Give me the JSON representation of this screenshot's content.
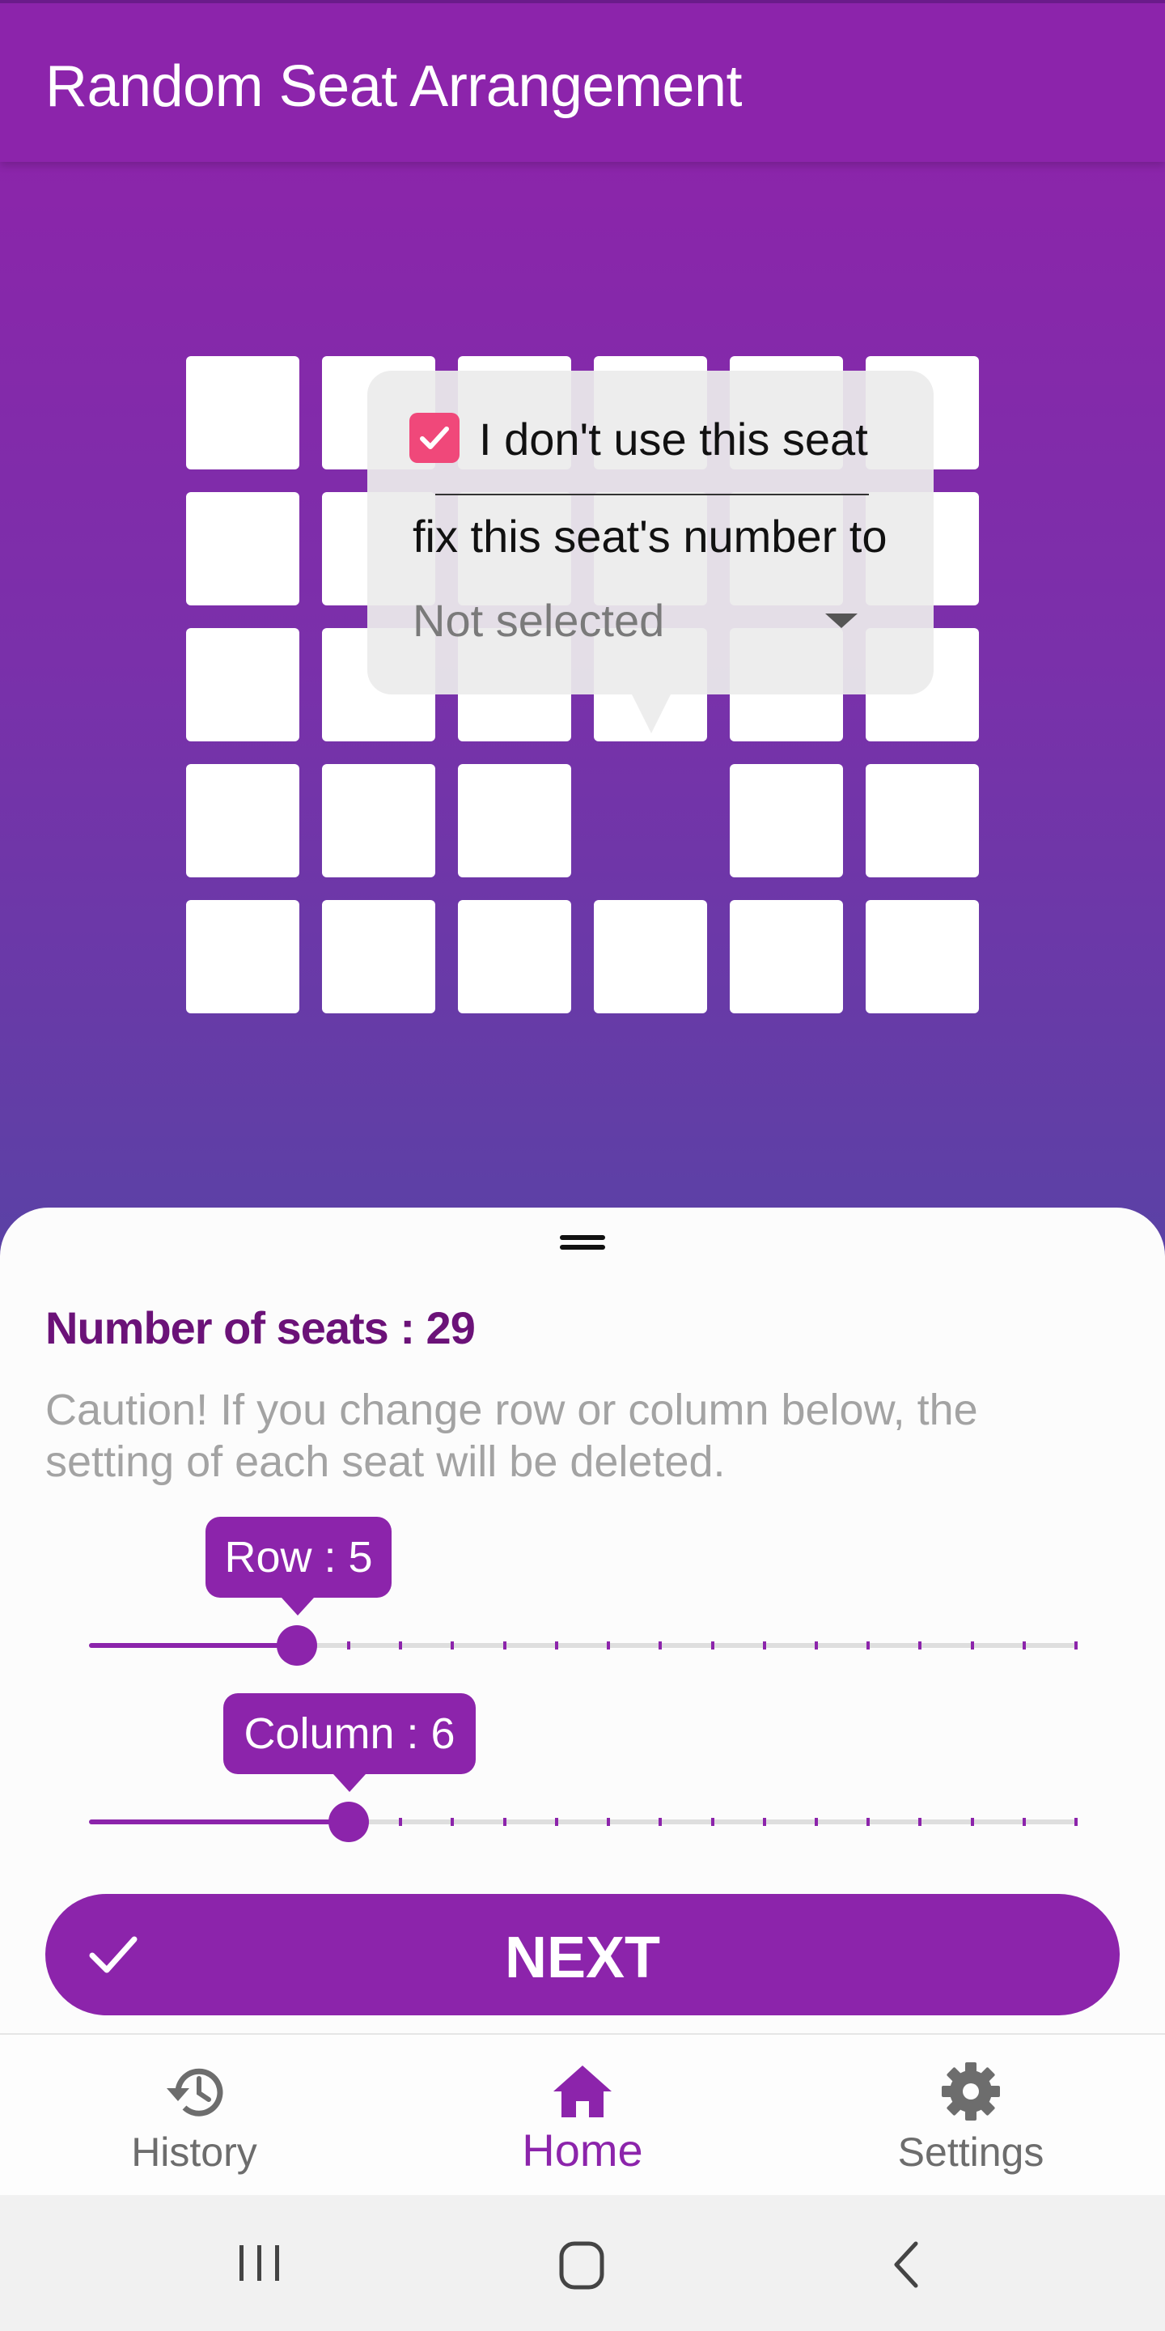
{
  "app_bar": {
    "title": "Random Seat Arrangement"
  },
  "seat_grid": {
    "rows": 5,
    "columns": 6,
    "unused_seats": [
      [
        3,
        3
      ]
    ]
  },
  "seat_popup": {
    "checkbox_label": "I don't use this seat",
    "checkbox_checked": true,
    "fix_label": "fix this seat's number to",
    "select_value": "Not selected"
  },
  "sheet": {
    "seat_count": "Number of seats : 29",
    "caution": "Caution! If you change row or column below, the setting of each seat will be deleted.",
    "row_slider": {
      "label": "Row : 5",
      "value": 5,
      "min": 1,
      "max": 20
    },
    "column_slider": {
      "label": "Column : 6",
      "value": 6,
      "min": 1,
      "max": 20
    },
    "next_button": "NEXT"
  },
  "bottom_nav": {
    "items": [
      {
        "label": "History",
        "icon": "history-icon",
        "active": false
      },
      {
        "label": "Home",
        "icon": "home-icon",
        "active": true
      },
      {
        "label": "Settings",
        "icon": "gear-icon",
        "active": false
      }
    ]
  },
  "colors": {
    "primary": "#8c24ab",
    "checkbox": "#f0487a",
    "seat_count_text": "#6b1278"
  }
}
